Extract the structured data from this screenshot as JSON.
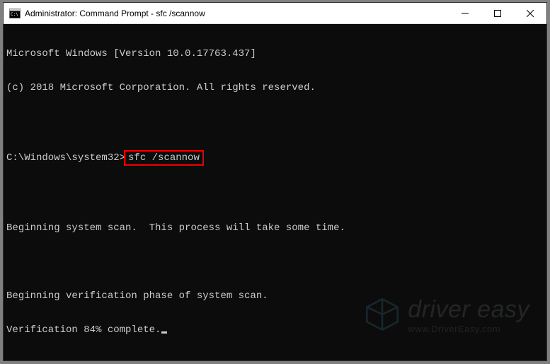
{
  "window": {
    "title": "Administrator: Command Prompt - sfc  /scannow"
  },
  "terminal": {
    "lines": {
      "l0": "Microsoft Windows [Version 10.0.17763.437]",
      "l1": "(c) 2018 Microsoft Corporation. All rights reserved.",
      "l2": "",
      "prompt": "C:\\Windows\\system32>",
      "command": "sfc /scannow",
      "l4": "",
      "l5": "Beginning system scan.  This process will take some time.",
      "l6": "",
      "l7": "Beginning verification phase of system scan.",
      "l8": "Verification 84% complete."
    }
  },
  "watermark": {
    "brand_driver": "driver",
    "brand_easy": " easy",
    "url": "www.DriverEasy.com"
  }
}
